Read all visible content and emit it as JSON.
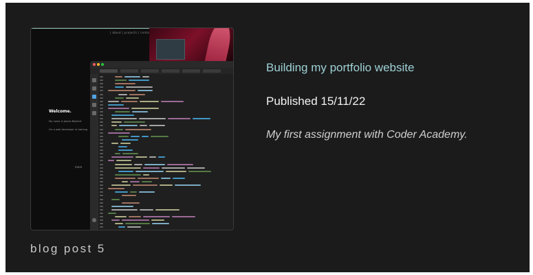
{
  "post": {
    "title": "Building my portfolio website",
    "date": "Published 15/11/22",
    "description": "My first assignment with Coder Academy.",
    "label": "blog post 5"
  },
  "thumbnail": {
    "nav": "| about | projects | contact |",
    "welcome_title": "Welcome.",
    "welcome_line1": "My name is James Bejsfort",
    "welcome_line2": "I'm a web developer in training",
    "more_label": "more"
  },
  "colors": {
    "background": "#1b1b1b",
    "title_accent": "#9fd1d6",
    "text": "#f2f2f2"
  }
}
